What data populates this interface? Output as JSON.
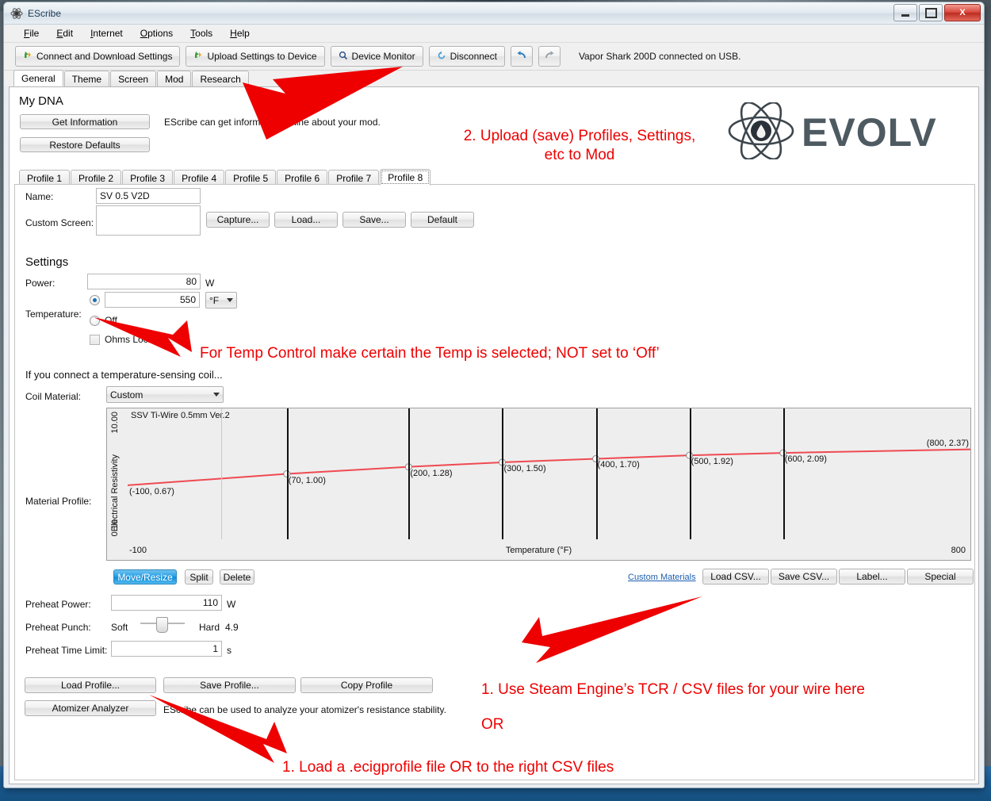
{
  "window": {
    "title": "EScribe",
    "icon": "atom-icon",
    "buttons": {
      "minimize": "minimize-icon",
      "maximize": "maximize-icon",
      "close": "X"
    }
  },
  "menu": {
    "items": [
      "File",
      "Edit",
      "Internet",
      "Options",
      "Tools",
      "Help"
    ]
  },
  "toolbar": {
    "connect_label": "Connect and Download Settings",
    "upload_label": "Upload Settings to Device",
    "monitor_label": "Device Monitor",
    "disconnect_label": "Disconnect",
    "undo_label": "↶",
    "redo_label": "↷",
    "status": "Vapor Shark 200D connected on USB."
  },
  "main_tabs": {
    "items": [
      "General",
      "Theme",
      "Screen",
      "Mod",
      "Research"
    ],
    "active": "General"
  },
  "my_dna": {
    "heading": "My DNA",
    "get_information": "Get Information",
    "restore_defaults": "Restore Defaults",
    "hint": "EScribe can get information online about your mod."
  },
  "profile_tabs": {
    "items": [
      "Profile 1",
      "Profile 2",
      "Profile 3",
      "Profile 4",
      "Profile 5",
      "Profile 6",
      "Profile 7",
      "Profile 8"
    ],
    "active": "Profile 8"
  },
  "profile": {
    "name_label": "Name:",
    "name_value": "SV 0.5 V2D",
    "custom_screen_label": "Custom Screen:",
    "custom_screen_value": "",
    "capture_button": "Capture...",
    "load_button": "Load...",
    "save_button": "Save...",
    "default_button": "Default"
  },
  "settings": {
    "heading": "Settings",
    "power_label": "Power:",
    "power_value": "80",
    "power_unit": "W",
    "temperature_label": "Temperature:",
    "temperature_value": "550",
    "temperature_unit": "°F",
    "temperature_selected": true,
    "off_label": "Off",
    "ohms_locked_label": "Ohms Locked",
    "ohms_locked_checked": false
  },
  "coil": {
    "section_note": "If you connect a temperature-sensing coil...",
    "material_label": "Coil Material:",
    "material_value": "Custom",
    "material_profile_label": "Material Profile:"
  },
  "chart_data": {
    "type": "line",
    "title": "SSV Ti-Wire 0.5mm Ver.2",
    "xlabel": "Temperature (°F)",
    "ylabel": "Electrical Resistivity",
    "xlim": [
      -100,
      800
    ],
    "ylim": [
      0.1,
      10.0
    ],
    "yscale": "log",
    "ytick_labels": [
      "10.00",
      "0.10"
    ],
    "xtick_labels": [
      "-100",
      "800"
    ],
    "grid": false,
    "legend": "none",
    "x": [
      -100,
      70,
      200,
      300,
      400,
      500,
      600,
      800
    ],
    "y": [
      0.67,
      1.0,
      1.28,
      1.5,
      1.7,
      1.92,
      2.09,
      2.37
    ],
    "point_labels": [
      "(-100, 0.67)",
      "(70, 1.00)",
      "(200, 1.28)",
      "(300, 1.50)",
      "(400, 1.70)",
      "(500, 1.92)",
      "(600, 2.09)",
      "(800, 2.37)"
    ],
    "series_color": "#ef4a52",
    "segment_divider_x": [
      70,
      200,
      300,
      400,
      500,
      600
    ],
    "faint_divider_x": [
      0
    ]
  },
  "chart_tools": {
    "move_resize": "Move/Resize",
    "split": "Split",
    "delete": "Delete",
    "custom_materials_link": "Custom Materials",
    "load_csv": "Load CSV...",
    "save_csv": "Save CSV...",
    "label": "Label...",
    "special": "Special"
  },
  "preheat": {
    "power_label": "Preheat Power:",
    "power_value": "110",
    "power_unit": "W",
    "punch_label": "Preheat Punch:",
    "punch_soft": "Soft",
    "punch_hard": "Hard",
    "punch_value": "4.9",
    "time_label": "Preheat Time Limit:",
    "time_value": "1",
    "time_unit": "s"
  },
  "profile_actions": {
    "load_profile": "Load Profile...",
    "save_profile": "Save Profile...",
    "copy_profile": "Copy Profile",
    "atomizer_analyzer": "Atomizer Analyzer",
    "analyzer_hint": "EScribe can be used to analyze your atomizer's resistance stability."
  },
  "annotations": {
    "accent_color": "#ee0000",
    "upload": "2. Upload (save) Profiles, Settings,\netc to Mod",
    "temp": "For Temp Control make certain the Temp is selected; NOT set to ‘Off’",
    "csv": "1. Use Steam Engine’s TCR / CSV files for your wire here",
    "csv_or": "OR",
    "load": "1. Load a .ecigprofile file OR to the right CSV files"
  },
  "brand": {
    "name": "EVOLV",
    "logo": "atom-logo-icon"
  }
}
